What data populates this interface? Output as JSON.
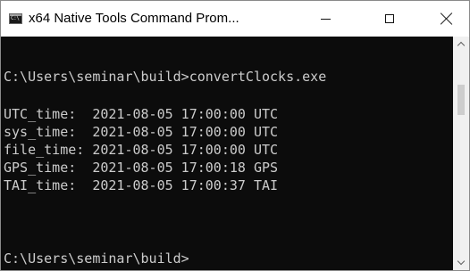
{
  "window": {
    "title": "x64 Native Tools Command Prom...",
    "app_icon_text": "C:\\",
    "icon": "command-prompt-icon"
  },
  "controls": {
    "minimize_icon": "minimize-icon",
    "maximize_icon": "maximize-icon",
    "close_icon": "close-icon"
  },
  "console": {
    "lines": [
      "",
      "C:\\Users\\seminar\\build>convertClocks.exe",
      "",
      "UTC_time:  2021-08-05 17:00:00 UTC",
      "sys_time:  2021-08-05 17:00:00 UTC",
      "file_time: 2021-08-05 17:00:00 UTC",
      "GPS_time:  2021-08-05 17:00:18 GPS",
      "TAI_time:  2021-08-05 17:00:37 TAI",
      "",
      "",
      "",
      "C:\\Users\\seminar\\build>"
    ],
    "foreground_color": "#cccccc",
    "background_color": "#0c0c0c"
  }
}
